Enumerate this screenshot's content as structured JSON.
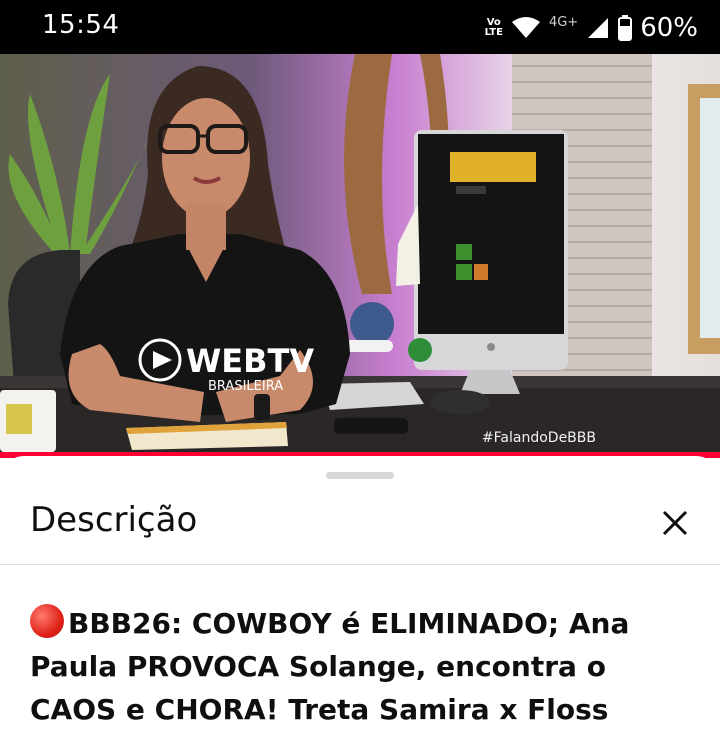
{
  "status_bar": {
    "time": "15:54",
    "volte_top": "Vo",
    "volte_bottom": "LTE",
    "network": "4G+",
    "battery": "60%"
  },
  "video": {
    "hashtag": "#FalandoDeBBB",
    "shirt_text_top": "WEBTV",
    "shirt_text_bottom": "BRASILEIRA",
    "progress_color": "#ff0033"
  },
  "description_sheet": {
    "title": "Descrição",
    "close_icon": "close-icon",
    "video_title": "BBB26: COWBOY é ELIMINADO; Ana Paula PROVOCA Solange, encontra o CAOS e CHORA! Treta Samira x Floss"
  }
}
